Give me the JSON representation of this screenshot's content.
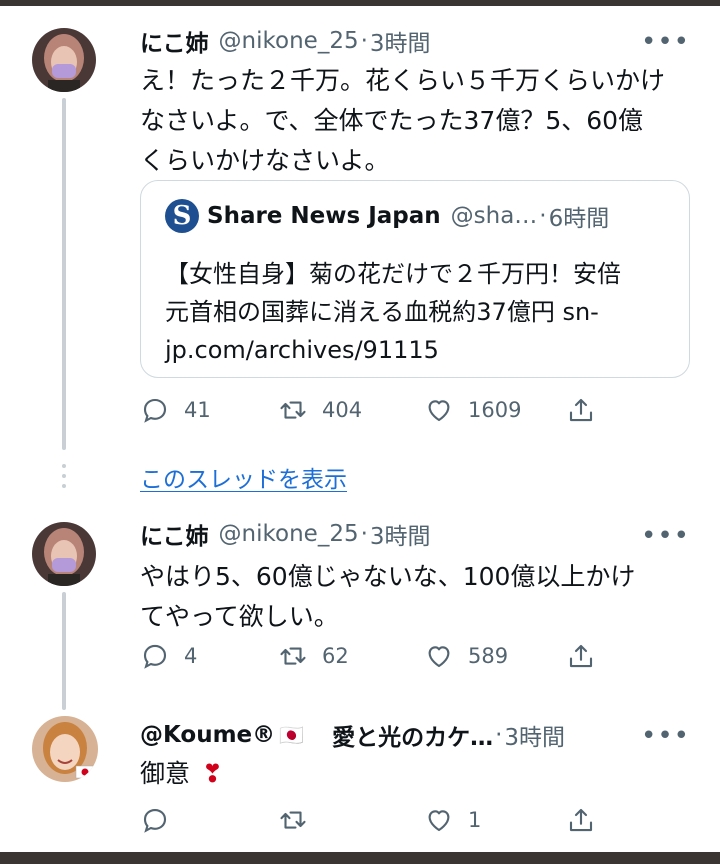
{
  "colors": {
    "text": "#0f1419",
    "secondary": "#536471",
    "link": "#1d6fd8",
    "heart_red": "#d0021b",
    "border": "#cfd9de",
    "share_news_blue": "#1d4f91"
  },
  "tweets": [
    {
      "name": "にこ姉",
      "handle": "@nikone_25",
      "separator": "·",
      "time": "3時間",
      "more": "•••",
      "text_lines": [
        "え！たった２千万。花くらい５千万くらいかけ",
        "なさいよ。で、全体でたった37億？5、60億",
        "くらいかけなさいよ。"
      ],
      "actions": {
        "reply": "41",
        "retweet": "404",
        "like": "1609"
      }
    },
    {
      "name": "にこ姉",
      "handle": "@nikone_25",
      "separator": "·",
      "time": "3時間",
      "more": "•••",
      "text_lines": [
        "やはり5、60億じゃないな、100億以上かけ",
        "てやって欲しい。"
      ],
      "actions": {
        "reply": "4",
        "retweet": "62",
        "like": "589"
      }
    },
    {
      "name": "@Koume®",
      "flag": "🇯🇵",
      "display_suffix": "愛と光のカケ…",
      "separator": "·",
      "time": "3時間",
      "more": "•••",
      "text": "御意",
      "emoji": "❣",
      "actions": {
        "reply": "",
        "retweet": "",
        "like": "1"
      }
    }
  ],
  "quote": {
    "logo_letter": "S",
    "name": "Share News Japan",
    "handle": "@sha…",
    "separator": "·",
    "time": "6時間",
    "text_lines": [
      "【女性自身】菊の花だけで２千万円！安倍",
      "元首相の国葬に消える血税約37億円 sn-",
      "jp.com/archives/91115"
    ]
  },
  "show_thread": "このスレッドを表示",
  "icons": [
    "reply-icon",
    "retweet-icon",
    "like-icon",
    "share-icon",
    "more-icon"
  ]
}
